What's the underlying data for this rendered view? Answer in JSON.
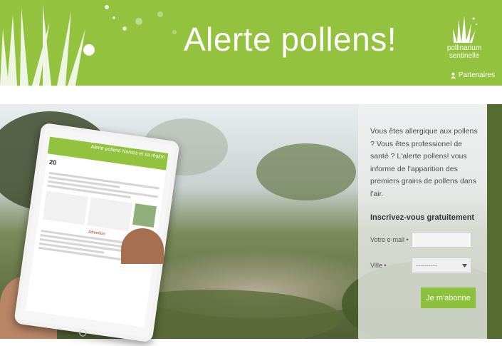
{
  "banner": {
    "title": "Alerte pollens!",
    "brand_name": "pollinarium",
    "brand_sub": "sentinelle",
    "partners_label": "Partenaires",
    "color": "#93c23f"
  },
  "tablet": {
    "banner_text": "Alerte pollens\nNantes et sa région",
    "date_day": "20",
    "alert_text": "Attention"
  },
  "signup": {
    "intro": "Vous êtes allergique aux pollens ? Vous êtes professionel de santé ? L'alerte pollens! vous informe de l'apparition des premiers grains de pollens dans l'air.",
    "title": "Inscrivez-vous gratuitement",
    "email_label": "Votre e-mail •",
    "email_value": "",
    "city_label": "Ville •",
    "city_value": "----------",
    "button_label": "Je m'abonne",
    "button_color": "#8cc23b"
  },
  "icons": {
    "partners": "person-icon",
    "logo": "grass-logo-icon",
    "dropdown": "chevron-down-icon"
  }
}
